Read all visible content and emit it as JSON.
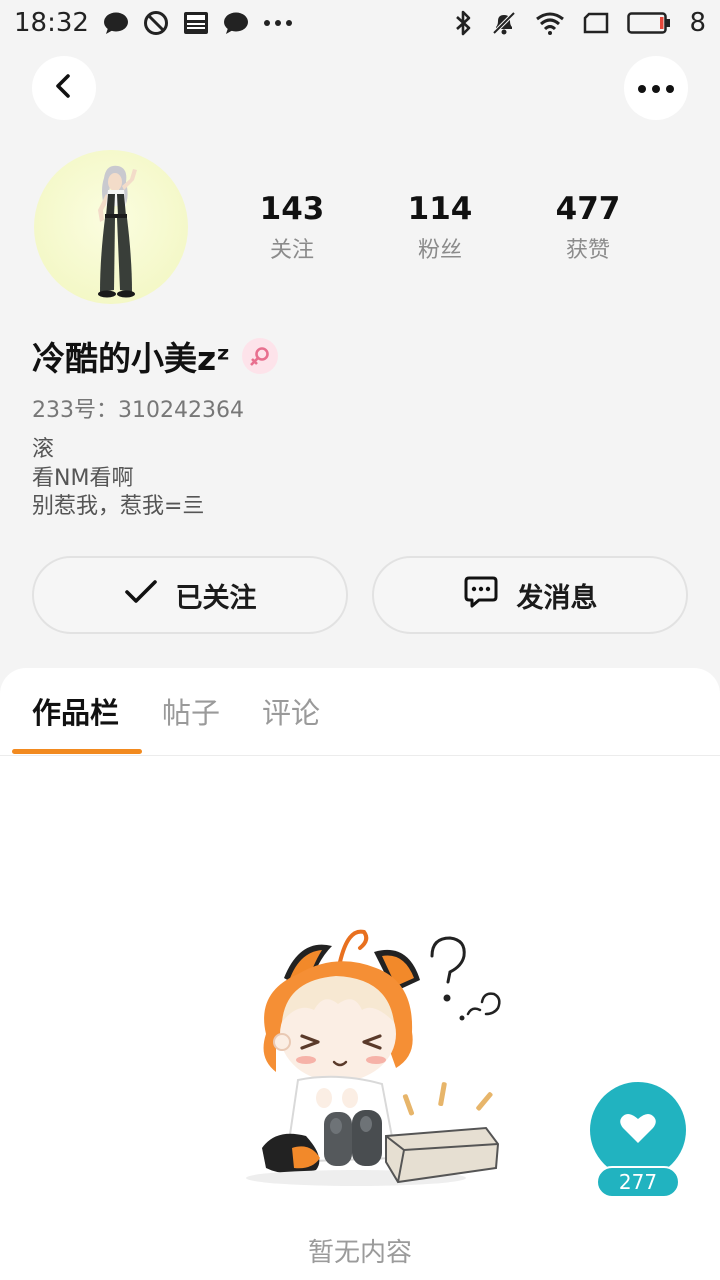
{
  "status_bar": {
    "time": "18:32",
    "battery_level": "8",
    "left_icons": [
      "chat-bubble-icon",
      "block-icon",
      "news-icon",
      "chat-bubble-icon",
      "more-dots-icon"
    ],
    "right_icons": [
      "bluetooth-icon",
      "mute-icon",
      "wifi-icon",
      "sim-icon",
      "battery-icon"
    ]
  },
  "header": {
    "back_icon": "chevron-left-icon",
    "more_icon": "more-dots-icon"
  },
  "profile": {
    "name": "冷酷的小美zᶻ",
    "gender_icon": "female-icon",
    "uid": "233号：310242364",
    "bio": [
      "滚",
      "看NM看啊",
      "别惹我，惹我=亖"
    ],
    "stats": [
      {
        "value": "143",
        "label": "关注"
      },
      {
        "value": "114",
        "label": "粉丝"
      },
      {
        "value": "477",
        "label": "获赞"
      }
    ]
  },
  "actions": {
    "follow_label": "已关注",
    "message_label": "发消息"
  },
  "tabs": [
    {
      "label": "作品栏",
      "active": true
    },
    {
      "label": "帖子",
      "active": false
    },
    {
      "label": "评论",
      "active": false
    }
  ],
  "empty_state": {
    "text": "暂无内容"
  },
  "like_button": {
    "count": "277"
  },
  "colors": {
    "accent_orange": "#f28a1f",
    "like_teal": "#21b3c0",
    "gender_pink": "#e8708f"
  }
}
